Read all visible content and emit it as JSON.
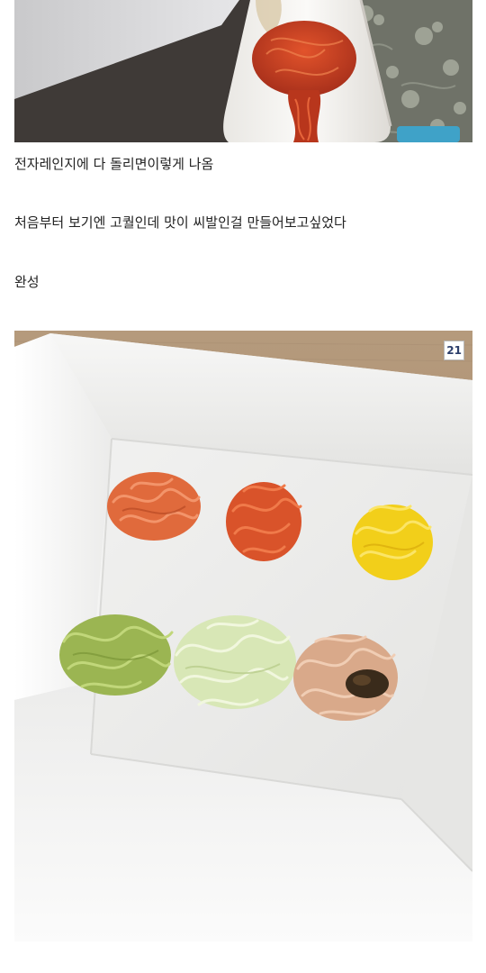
{
  "captions": [
    "전자레인지에 다 돌리면이렇게 나옴",
    "처음부터 보기엔 고퀄인데 맛이 씨발인걸 만들어보고싶었다",
    "완성"
  ],
  "photo_badge": "21",
  "photos": {
    "top": "paper cup with red noodles pouring out onto a white tray, grey floral fabric in background",
    "bottom": "white square plate with six small mounds of colored noodles: orange, red-orange, yellow, green, pale green, and light brown topped with dark sauce"
  }
}
